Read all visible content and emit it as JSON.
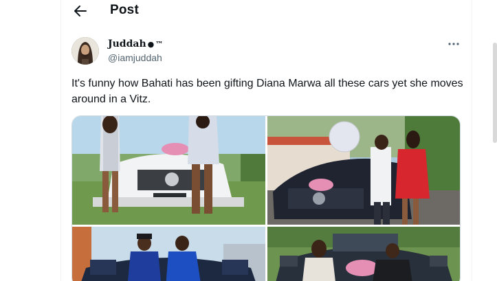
{
  "header": {
    "title": "Post"
  },
  "author": {
    "display_name": "Juddah",
    "name_glyph": "",
    "name_suffix": "™",
    "handle": "@iamjuddah"
  },
  "post": {
    "text": "It's funny how Bahati has been gifting Diana Marwa all these cars yet she moves around in a Vitz."
  },
  "icons": {
    "back": "arrow-left-icon",
    "more": "more-horizontal-icon"
  },
  "colors": {
    "text": "#0f1419",
    "secondary": "#536471",
    "border": "#eff3f4"
  }
}
